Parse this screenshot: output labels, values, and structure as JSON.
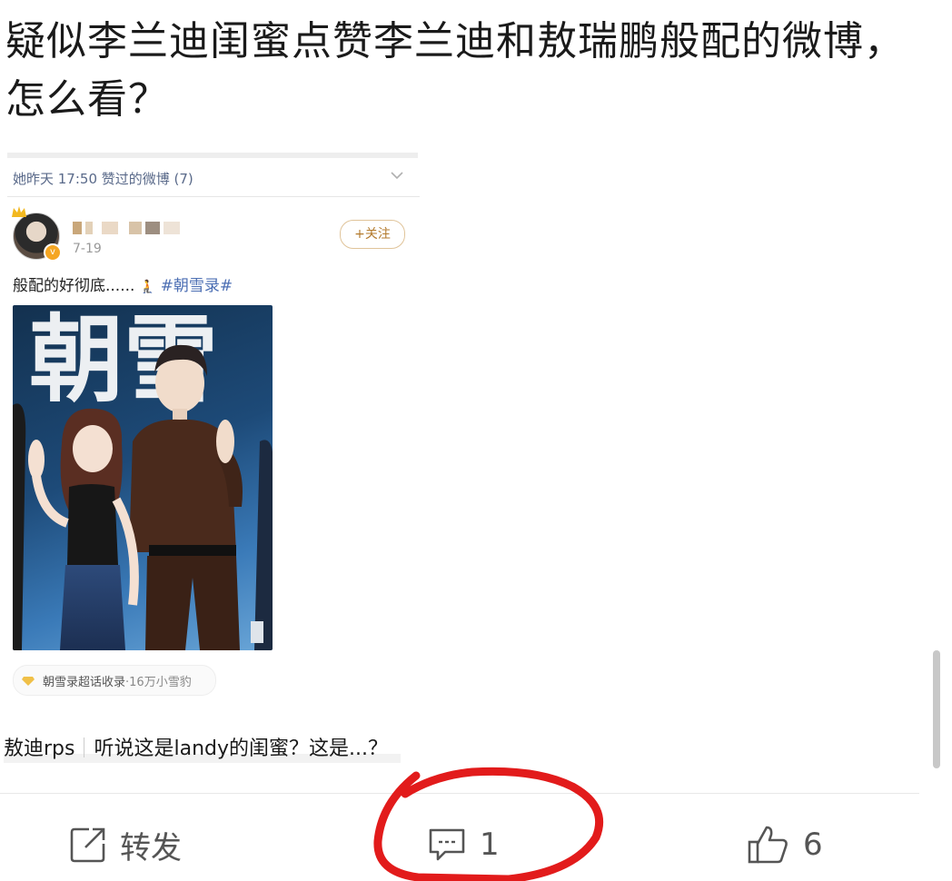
{
  "post": {
    "title": "疑似李兰迪闺蜜点赞李兰迪和敖瑞鹏般配的微博，怎么看？"
  },
  "embedded_screenshot": {
    "liked_header": "她昨天 17:50 赞过的微博 (7)",
    "date": "7-19",
    "follow_label": "+关注",
    "caption_text": "般配的好彻底......",
    "caption_emoji": "🧎",
    "caption_tag": "#朝雪录#",
    "photo_text": "朝雪",
    "super_topic_label": "朝雪录超话收录",
    "super_topic_count": "·16万小雪豹"
  },
  "source": {
    "topic": "敖迪rps",
    "title": "听说这是landy的闺蜜？这是...？"
  },
  "actions": {
    "repost_label": "转发",
    "comment_count": "1",
    "like_count": "6"
  },
  "colors": {
    "tag_blue": "#4b6eb3",
    "annotation_red": "#e21b1b",
    "follow_gold": "#b37a2c"
  }
}
